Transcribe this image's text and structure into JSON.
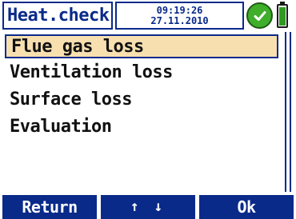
{
  "header": {
    "title": "Heat.check",
    "time": "09:19:26",
    "date": "27.11.2010",
    "status_icon": "check-circle-icon",
    "battery_icon": "battery-icon",
    "battery_level": 0.85
  },
  "menu": {
    "items": [
      {
        "label": "Flue gas loss",
        "selected": true
      },
      {
        "label": "Ventilation loss",
        "selected": false
      },
      {
        "label": "Surface loss",
        "selected": false
      },
      {
        "label": "Evaluation",
        "selected": false
      }
    ]
  },
  "softkeys": {
    "left": "Return",
    "middle": "↑ ↓",
    "right": "Ok"
  },
  "colors": {
    "accent": "#0a2a8a",
    "selection": "#f7dfb0",
    "status_ok": "#3fae2a"
  }
}
